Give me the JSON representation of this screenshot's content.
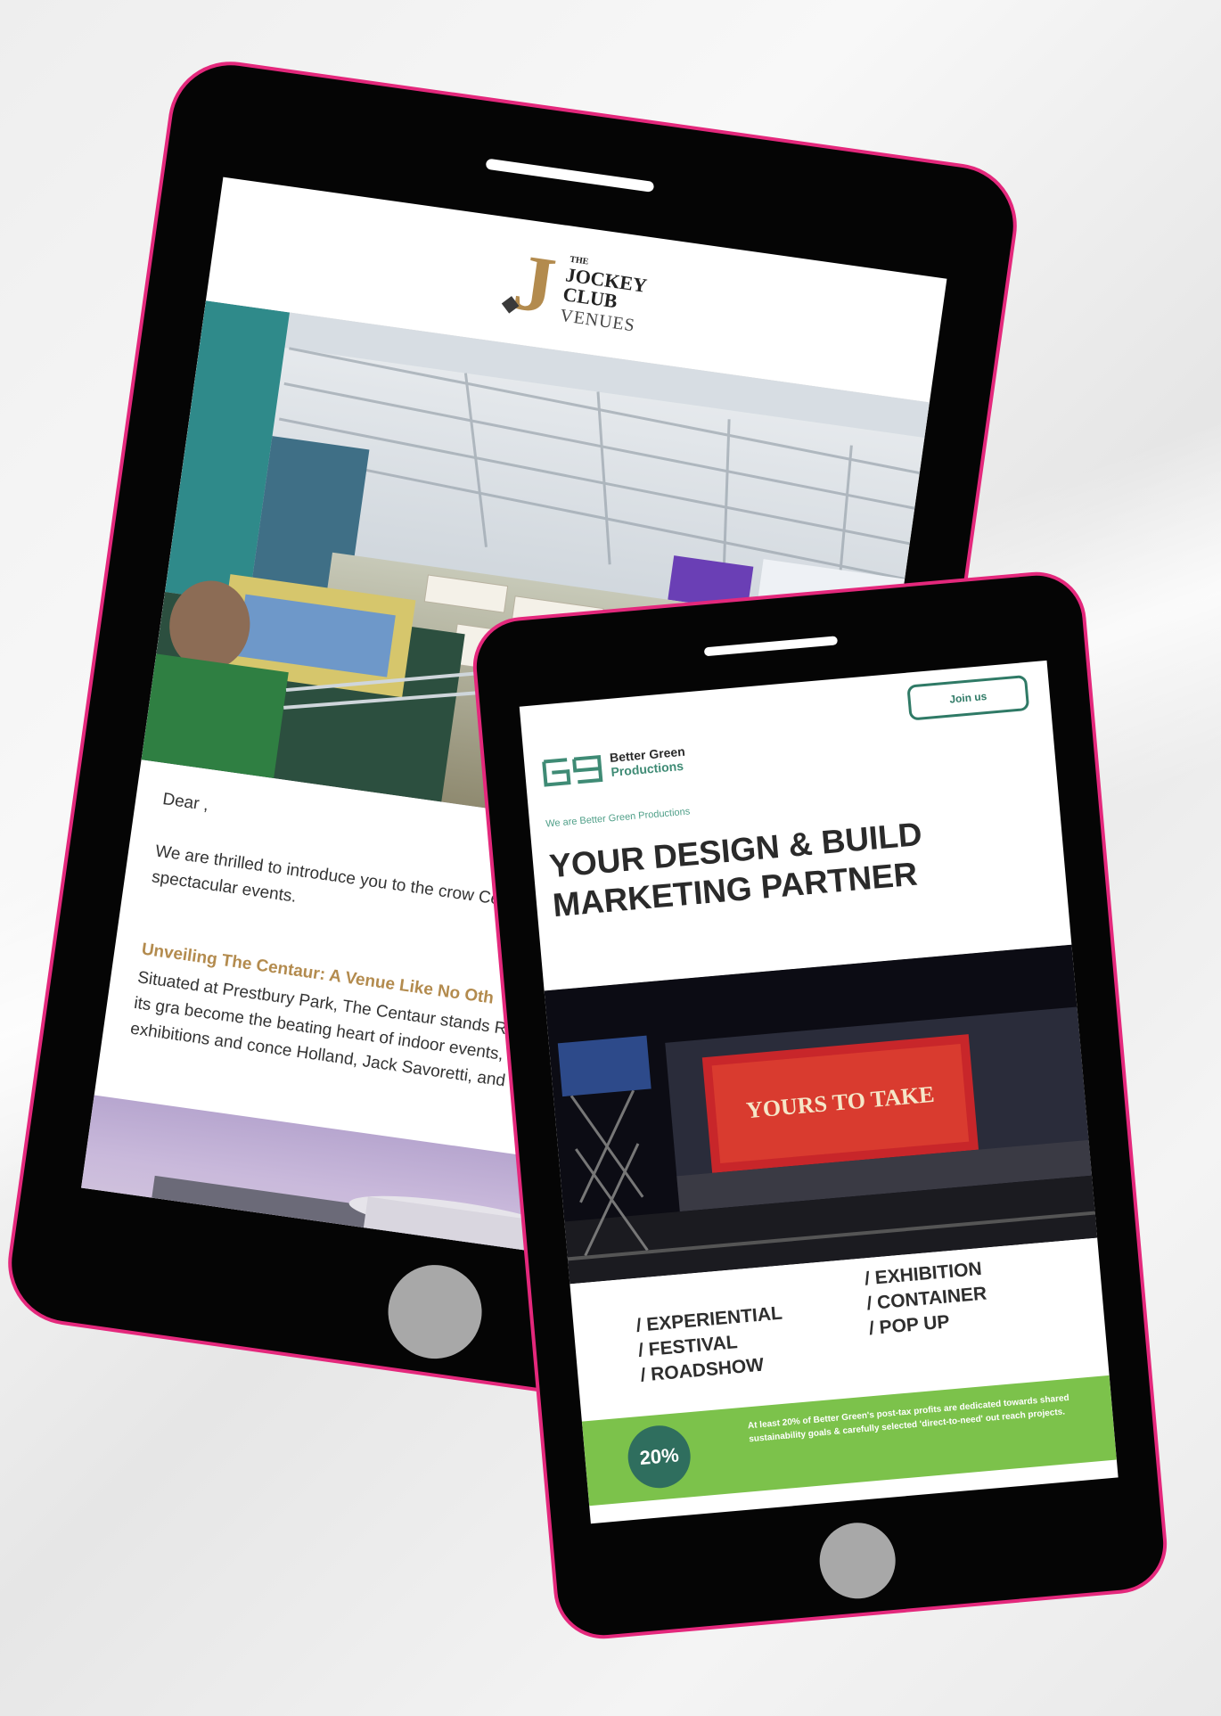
{
  "tablet1": {
    "logo": {
      "the": "THE",
      "line1": "JOCKEY",
      "line2": "CLUB",
      "venues": "VENUES",
      "brand_color": "#b38b4e"
    },
    "greeting": "Dear ,",
    "intro": "We are thrilled to introduce you to the crow Centaur, an iconic venue with a rich history spectacular events.",
    "subheading": "Unveiling The Centaur: A Venue Like No Oth",
    "body": "Situated at Prestbury Park, The Centaur stands Racecourse's legacy of excellence. Since its gra become the beating heart of indoor events, attrac ceremonies, and high-profile exhibitions and conce Holland, Jack Savoretti, and Rob Beckett."
  },
  "tablet2": {
    "join_label": "Join us",
    "logo_word1": "Better Green",
    "logo_word2": "Productions",
    "tagline": "We are Better Green Productions",
    "headline": "YOUR DESIGN & BUILD MARKETING PARTNER",
    "billboard": "YOURS TO TAKE",
    "services_left": [
      "/ EXPERIENTIAL",
      "/ FESTIVAL",
      "/ ROADSHOW"
    ],
    "services_right": [
      "/ EXHIBITION",
      "/ CONTAINER",
      "/ POP UP"
    ],
    "badge": "20%",
    "band_text": "At least 20% of Better Green's post-tax profits are dedicated towards shared sustainability goals & carefully selected 'direct-to-need' out reach projects.",
    "accent_green": "#7cc24b",
    "dark_green": "#2f6e5e"
  },
  "frame_color": "#e4287c"
}
